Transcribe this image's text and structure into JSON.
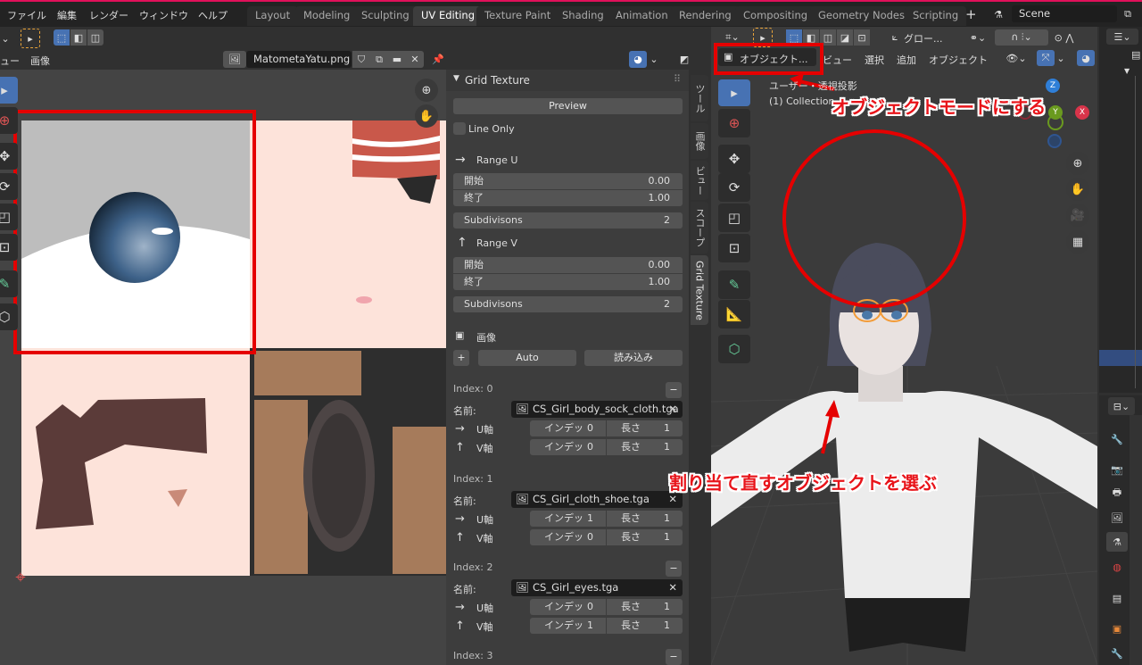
{
  "topbar": {
    "menus": [
      "ファイル",
      "編集",
      "レンダー",
      "ウィンドウ",
      "ヘルプ"
    ],
    "workspaces": [
      "Layout",
      "Modeling",
      "Sculpting",
      "UV Editing",
      "Texture Paint",
      "Shading",
      "Animation",
      "Rendering",
      "Compositing",
      "Geometry Nodes",
      "Scripting"
    ],
    "active_workspace": "UV Editing",
    "add_tab": "+",
    "scene": "Scene"
  },
  "uv_editor": {
    "menus": [
      "ュー",
      "画像"
    ],
    "image_name": "MatometaYatu.png"
  },
  "sidebar": {
    "panel_title": "Grid Texture",
    "preview": "Preview",
    "line_only": "Line Only",
    "line_only_checked": false,
    "range_u": {
      "label": "Range U",
      "start_label": "開始",
      "start": "0.00",
      "end_label": "終了",
      "end": "1.00",
      "subdiv_label": "Subdivisons",
      "subdiv": "2"
    },
    "range_v": {
      "label": "Range V",
      "start_label": "開始",
      "start": "0.00",
      "end_label": "終了",
      "end": "1.00",
      "subdiv_label": "Subdivisons",
      "subdiv": "2"
    },
    "image_label": "画像",
    "add": "+",
    "auto": "Auto",
    "load": "読み込み",
    "name_label": "名前:",
    "u_label": "U軸",
    "v_label": "V軸",
    "index_label": "インデッ",
    "length_label": "長さ",
    "entries": [
      {
        "index": "Index: 0",
        "file": "CS_Girl_body_sock_cloth.tga",
        "u_index": "0",
        "u_len": "1",
        "v_index": "0",
        "v_len": "1"
      },
      {
        "index": "Index: 1",
        "file": "CS_Girl_cloth_shoe.tga",
        "u_index": "1",
        "u_len": "1",
        "v_index": "0",
        "v_len": "1"
      },
      {
        "index": "Index: 2",
        "file": "CS_Girl_eyes.tga",
        "u_index": "0",
        "u_len": "1",
        "v_index": "1",
        "v_len": "1"
      },
      {
        "index": "Index: 3"
      }
    ],
    "tabs": [
      "ツール",
      "画像",
      "ビュー",
      "スコープ",
      "Grid Texture"
    ]
  },
  "viewport": {
    "mode": "オブジェクト...",
    "menus": [
      "ビュー",
      "選択",
      "追加",
      "オブジェクト"
    ],
    "transform": "グロー...",
    "overlay_line1": "ユーザー・透視投影",
    "overlay_line2": "(1) Collection",
    "gizmo": {
      "z": "Z",
      "y": "Y",
      "x": "X"
    }
  },
  "annotations": {
    "mode_note": "オブジェクトモードにする",
    "select_note": "割り当て直すオブジェクトを選ぶ",
    "color": "#e8141a"
  },
  "colors": {
    "accent": "#4772b3",
    "header": "#303030",
    "topbar": "#232323"
  }
}
